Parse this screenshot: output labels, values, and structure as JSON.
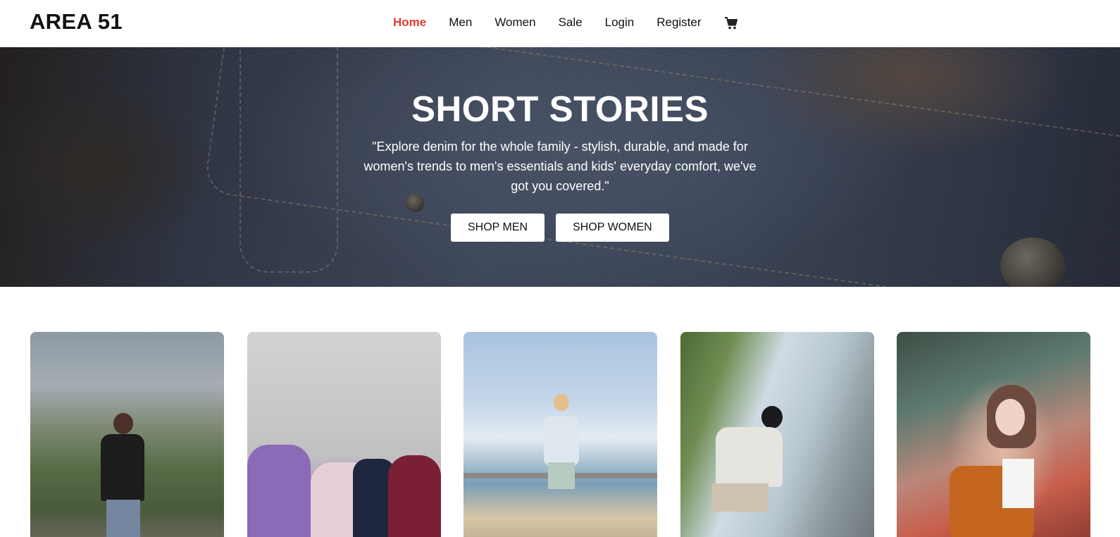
{
  "brand": {
    "logo": "AREA 51"
  },
  "nav": {
    "items": [
      {
        "label": "Home",
        "active": true
      },
      {
        "label": "Men",
        "active": false
      },
      {
        "label": "Women",
        "active": false
      },
      {
        "label": "Sale",
        "active": false
      },
      {
        "label": "Login",
        "active": false
      },
      {
        "label": "Register",
        "active": false
      }
    ],
    "cart_icon": "shopping-cart-icon",
    "active_color": "#e53935"
  },
  "hero": {
    "title": "SHORT STORIES",
    "description": "\"Explore denim for the whole family - stylish, durable, and made for women's trends to men's essentials and kids' everyday comfort, we've got you covered.\"",
    "buttons": {
      "shop_men": "SHOP MEN",
      "shop_women": "SHOP WOMEN"
    }
  },
  "gallery": {
    "images": [
      {
        "name": "woman-in-nature-photo"
      },
      {
        "name": "group-of-men-photo"
      },
      {
        "name": "woman-at-beach-photo"
      },
      {
        "name": "man-on-bridge-photo"
      },
      {
        "name": "woman-with-car-photo"
      }
    ]
  }
}
